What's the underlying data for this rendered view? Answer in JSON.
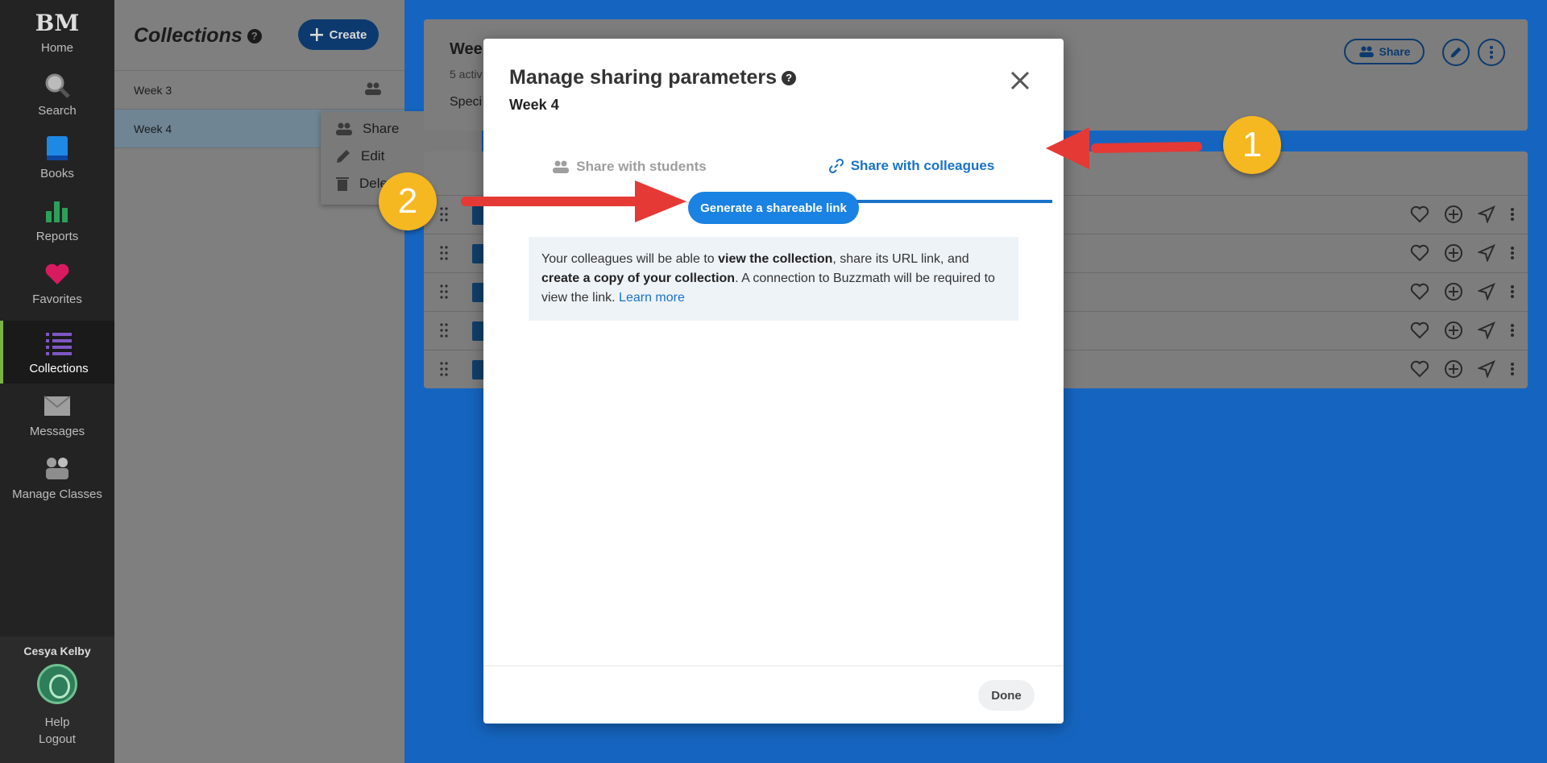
{
  "nav": {
    "logo": "BM",
    "items": [
      {
        "label": "Home"
      },
      {
        "label": "Search"
      },
      {
        "label": "Books"
      },
      {
        "label": "Reports"
      },
      {
        "label": "Favorites"
      },
      {
        "label": "Collections"
      },
      {
        "label": "Messages"
      },
      {
        "label": "Manage Classes"
      }
    ],
    "user_name": "Cesya Kelby",
    "help": "Help",
    "logout": "Logout"
  },
  "collections": {
    "title": "Collections",
    "help_glyph": "?",
    "create_label": "Create",
    "rows": [
      {
        "label": "Week 3"
      },
      {
        "label": "Week 4"
      }
    ]
  },
  "context_menu": {
    "share": "Share",
    "edit": "Edit",
    "delete": "Dele"
  },
  "main": {
    "title": "Wee",
    "subtitle": "5 activ",
    "special": "Speci",
    "share_label": "Share"
  },
  "modal": {
    "title": "Manage sharing parameters",
    "help_glyph": "?",
    "subtitle": "Week 4",
    "tab_students": "Share with students",
    "tab_colleagues": "Share with colleagues",
    "generate_label": "Generate a shareable link",
    "info_pre": "Your colleagues will be able to ",
    "info_b1": "view the collection",
    "info_mid": ", share its URL link, and ",
    "info_b2": "create a copy of your collection",
    "info_post": ". A connection to Buzzmath will be required to view the link. ",
    "learn_more": "Learn more",
    "done_label": "Done"
  },
  "annotations": {
    "badge1": "1",
    "badge2": "2",
    "arrow_color": "#e53935",
    "badge_color": "#f5b820"
  }
}
